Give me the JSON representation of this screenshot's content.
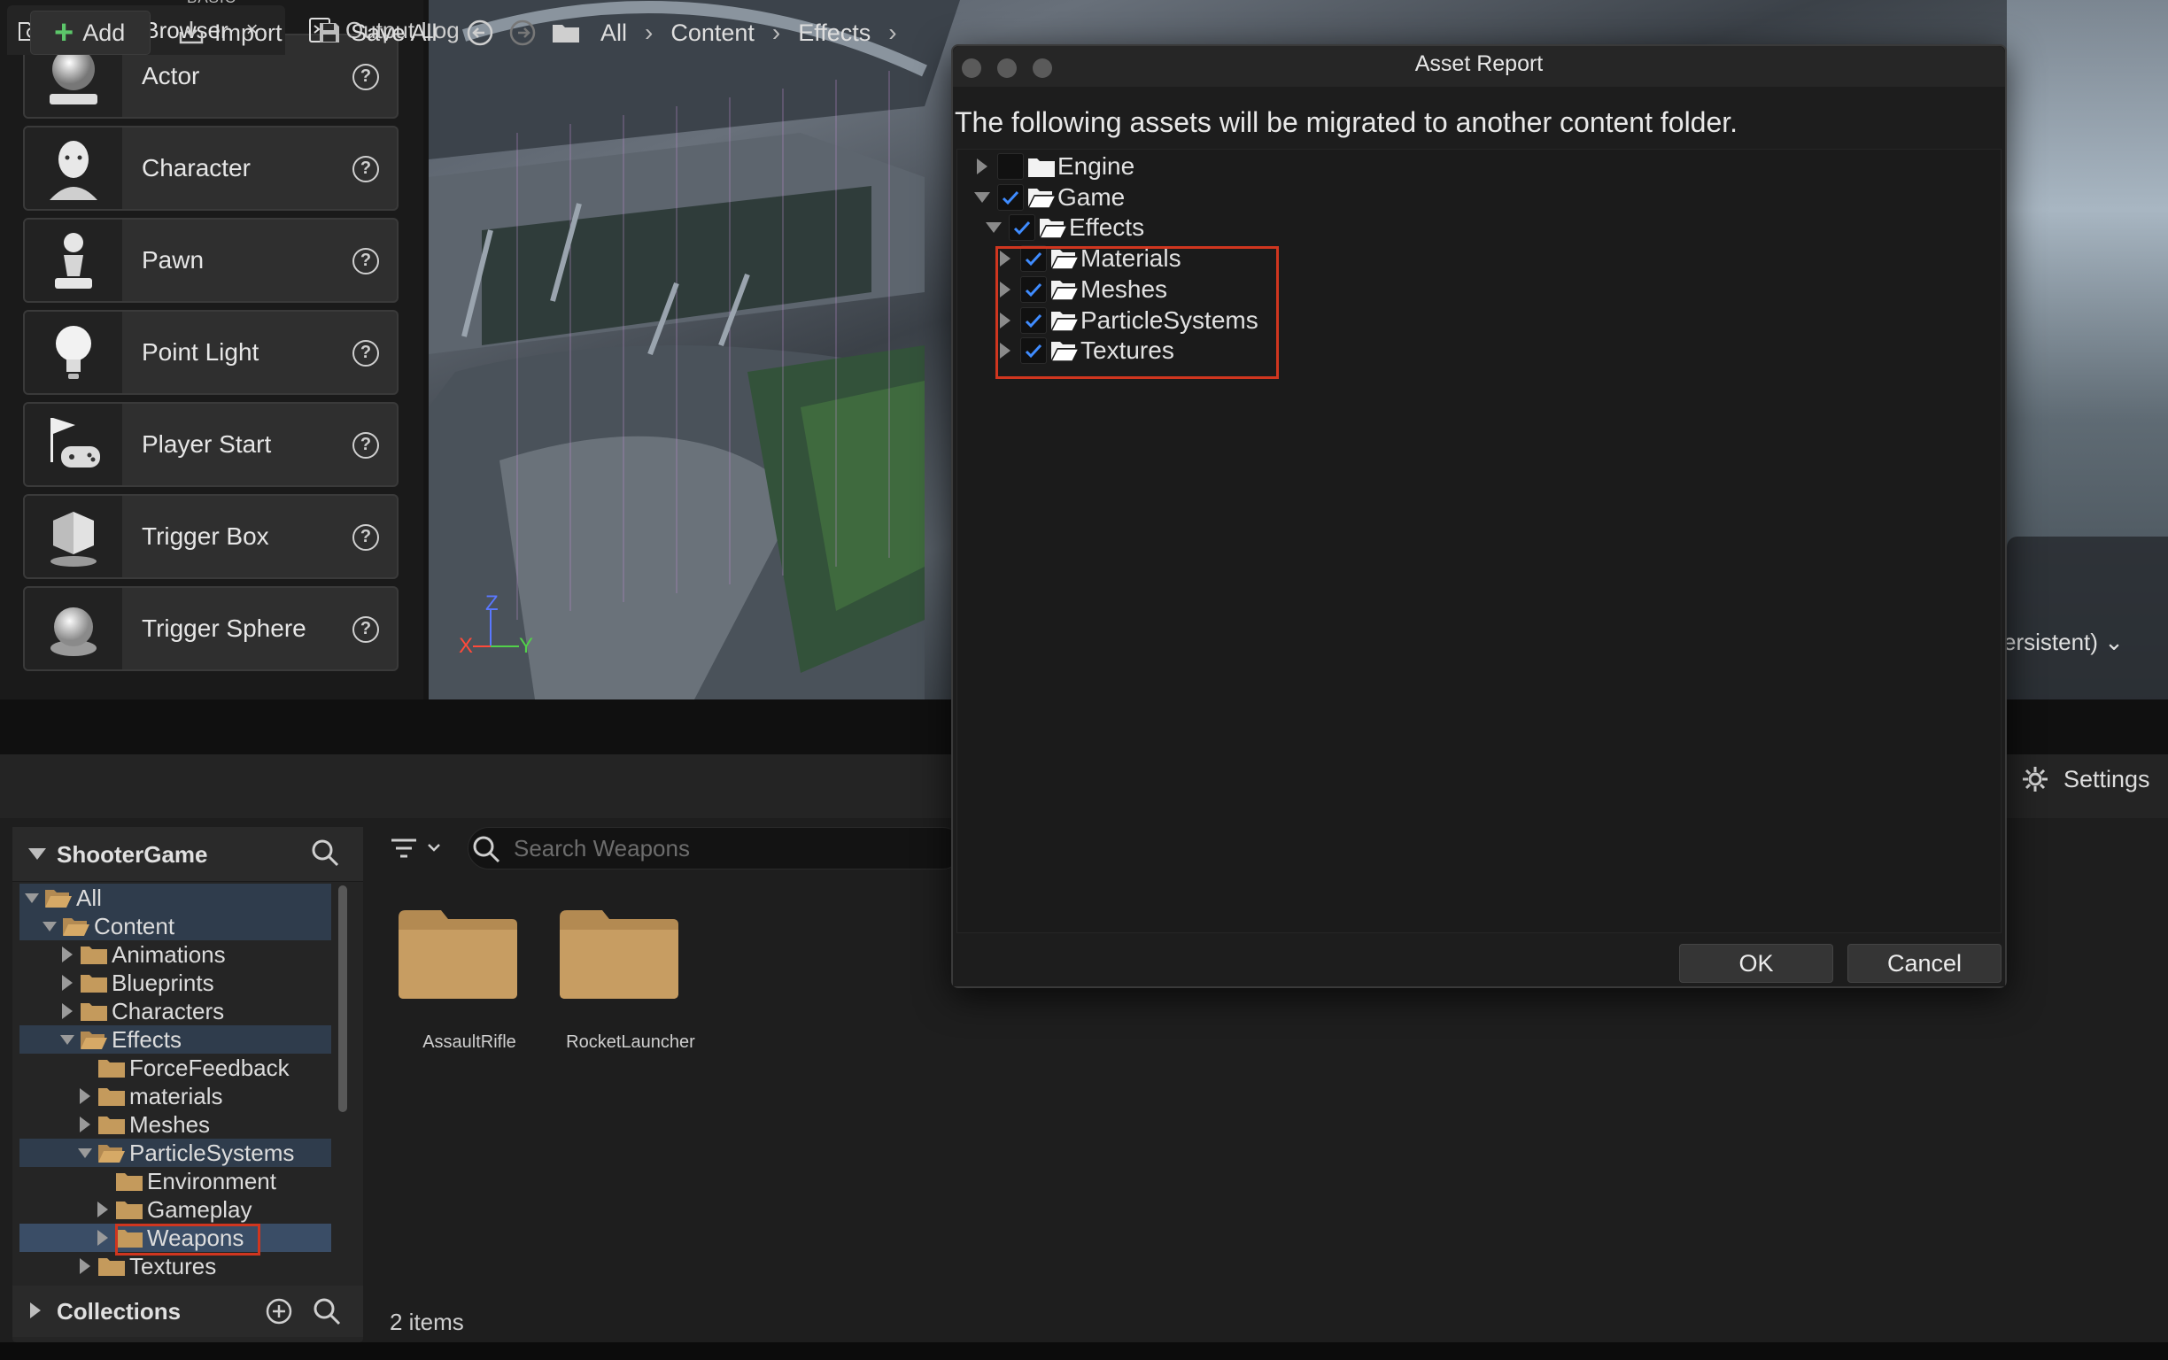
{
  "place_actors": {
    "section_label": "BASIC",
    "items": [
      {
        "label": "Actor",
        "icon": "sphere-icon"
      },
      {
        "label": "Character",
        "icon": "character-icon"
      },
      {
        "label": "Pawn",
        "icon": "pawn-icon"
      },
      {
        "label": "Point Light",
        "icon": "light-bulb-icon"
      },
      {
        "label": "Player Start",
        "icon": "player-start-icon"
      },
      {
        "label": "Trigger Box",
        "icon": "trigger-box-icon"
      },
      {
        "label": "Trigger Sphere",
        "icon": "trigger-sphere-icon"
      }
    ],
    "help_glyph": "?"
  },
  "viewport": {
    "axis_z": "Z",
    "axis_x": "X",
    "axis_y": "Y",
    "level_dropdown": "ersistent)"
  },
  "tabs": {
    "content_browser": "Content Browser",
    "close_glyph": "×",
    "output_log": "Output Log"
  },
  "toolbar": {
    "add": "Add",
    "import": "Import",
    "save_all": "Save All",
    "breadcrumb": [
      "All",
      "Content",
      "Effects"
    ],
    "settings": "Settings"
  },
  "sources": {
    "title": "ShooterGame",
    "tree": [
      {
        "label": "All",
        "depth": 0,
        "expanded": true
      },
      {
        "label": "Content",
        "depth": 1,
        "expanded": true
      },
      {
        "label": "Animations",
        "depth": 2,
        "expanded": false
      },
      {
        "label": "Blueprints",
        "depth": 2,
        "expanded": false
      },
      {
        "label": "Characters",
        "depth": 2,
        "expanded": false
      },
      {
        "label": "Effects",
        "depth": 2,
        "expanded": true
      },
      {
        "label": "ForceFeedback",
        "depth": 3,
        "expanded": null
      },
      {
        "label": "materials",
        "depth": 3,
        "expanded": false
      },
      {
        "label": "Meshes",
        "depth": 3,
        "expanded": false
      },
      {
        "label": "ParticleSystems",
        "depth": 3,
        "expanded": true
      },
      {
        "label": "Environment",
        "depth": 4,
        "expanded": null
      },
      {
        "label": "Gameplay",
        "depth": 4,
        "expanded": false
      },
      {
        "label": "Weapons",
        "depth": 4,
        "expanded": false
      },
      {
        "label": "Textures",
        "depth": 3,
        "expanded": false
      }
    ],
    "collections": "Collections"
  },
  "assets": {
    "search_placeholder": "Search Weapons",
    "items": [
      "AssaultRifle",
      "RocketLauncher"
    ],
    "count": "2 items"
  },
  "dialog": {
    "title": "Asset Report",
    "message": "The following assets will be migrated to another content folder.",
    "tree": [
      {
        "label": "Engine",
        "depth": 0,
        "checked": false,
        "expanded": false
      },
      {
        "label": "Game",
        "depth": 0,
        "checked": true,
        "expanded": true
      },
      {
        "label": "Effects",
        "depth": 1,
        "checked": true,
        "expanded": true
      },
      {
        "label": "Materials",
        "depth": 2,
        "checked": true,
        "expanded": false
      },
      {
        "label": "Meshes",
        "depth": 2,
        "checked": true,
        "expanded": false
      },
      {
        "label": "ParticleSystems",
        "depth": 2,
        "checked": true,
        "expanded": false
      },
      {
        "label": "Textures",
        "depth": 2,
        "checked": true,
        "expanded": false
      }
    ],
    "ok": "OK",
    "cancel": "Cancel"
  },
  "colors": {
    "highlight_red": "#d0361f",
    "check_blue": "#3f8cff",
    "folder_tan": "#c49a5c",
    "selection_blue": "#3a4d66"
  }
}
